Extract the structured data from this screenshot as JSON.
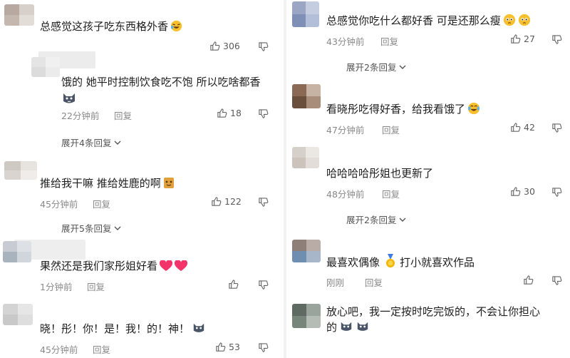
{
  "left": {
    "c1": {
      "text": "总感觉这孩子吃东西格外香",
      "likes": "306"
    },
    "c2": {
      "text": "饿的 她平时控制饮食吃不饱 所以吃啥都香",
      "time": "22分钟前",
      "reply": "回复",
      "likes": "18",
      "expand": "展开4条回复"
    },
    "c3": {
      "text": "推给我干嘛 推给姓鹿的啊",
      "time": "45分钟前",
      "reply": "回复",
      "likes": "122",
      "expand": "展开5条回复"
    },
    "c4": {
      "text": "果然还是我们家彤姐好看",
      "time": "1分钟前",
      "reply": "回复"
    },
    "c5": {
      "text": "晓！彤！你！是！我！的！神！",
      "time": "45分钟前",
      "reply": "回复",
      "likes": "53"
    }
  },
  "right": {
    "c1": {
      "text": "总感觉你吃什么都好香 可是还那么瘦",
      "time": "43分钟前",
      "reply": "回复",
      "likes": "27",
      "expand": "展开2条回复"
    },
    "c2": {
      "text": "看晓彤吃得好香，给我看饿了",
      "time": "47分钟前",
      "reply": "回复",
      "likes": "42"
    },
    "c3": {
      "text": "哈哈哈哈彤姐也更新了",
      "time": "48分钟前",
      "reply": "回复",
      "likes": "30",
      "expand": "展开2条回复"
    },
    "c4": {
      "text": "最喜欢偶像",
      "text2": "打小就喜欢作品",
      "time": "刚刚",
      "reply": "回复"
    },
    "c5": {
      "text": "放心吧，我一定按时吃完饭的，不会让你担心",
      "text2": "的"
    }
  }
}
